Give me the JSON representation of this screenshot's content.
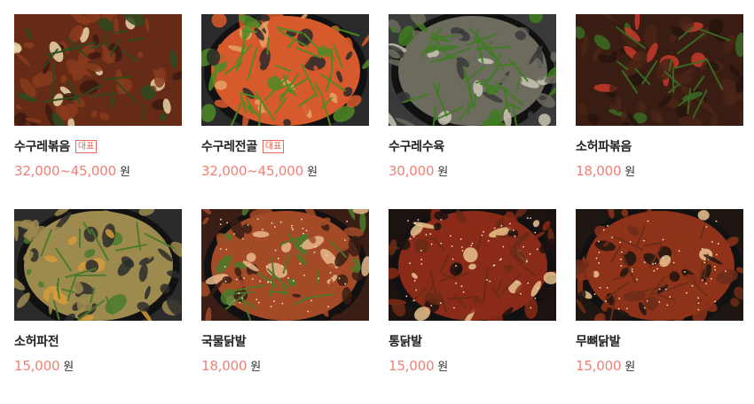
{
  "menu": {
    "items": [
      {
        "name": "수구레볶음",
        "badge": "대표",
        "price": "32,000~45,000",
        "unit": "원",
        "photo": "stir-fry-dark",
        "colors": {
          "bg": "#3b1a10",
          "accent": "#8a3b1c",
          "leaf": "#2d4a1e",
          "hi": "#e9d6a8"
        }
      },
      {
        "name": "수구레전골",
        "badge": "대표",
        "price": "32,000~45,000",
        "unit": "원",
        "photo": "hot-pot",
        "colors": {
          "bg": "#2a2a2c",
          "accent": "#d65a2c",
          "leaf": "#4f8a26",
          "hi": "#e6a267"
        }
      },
      {
        "name": "수구레수육",
        "badge": "",
        "price": "30,000",
        "unit": "원",
        "photo": "boiled-greens",
        "colors": {
          "bg": "#3a3a3a",
          "accent": "#6d6a5e",
          "leaf": "#3f7d21",
          "hi": "#c9c6b5"
        }
      },
      {
        "name": "소허파볶음",
        "badge": "",
        "price": "18,000",
        "unit": "원",
        "photo": "stir-fry-dark",
        "colors": {
          "bg": "#24140e",
          "accent": "#4a2418",
          "leaf": "#3a6b23",
          "hi": "#c5392a"
        }
      },
      {
        "name": "소허파전",
        "badge": "",
        "price": "15,000",
        "unit": "원",
        "photo": "pancake",
        "colors": {
          "bg": "#2b2b2b",
          "accent": "#9c8a4f",
          "leaf": "#4b7a2a",
          "hi": "#d79a3a"
        }
      },
      {
        "name": "국물닭발",
        "badge": "",
        "price": "18,000",
        "unit": "원",
        "photo": "spicy-feet",
        "colors": {
          "bg": "#3a1d14",
          "accent": "#a54a27",
          "leaf": "#4a7a2a",
          "hi": "#e8b98c"
        }
      },
      {
        "name": "통닭발",
        "badge": "",
        "price": "15,000",
        "unit": "원",
        "photo": "spicy-feet",
        "colors": {
          "bg": "#1c1210",
          "accent": "#8a2a18",
          "leaf": "#6a2a16",
          "hi": "#e7c38e"
        }
      },
      {
        "name": "무뼈닭발",
        "badge": "",
        "price": "15,000",
        "unit": "원",
        "photo": "spicy-feet",
        "colors": {
          "bg": "#1e1612",
          "accent": "#8e3219",
          "leaf": "#6c2d18",
          "hi": "#e9c392"
        }
      }
    ]
  }
}
